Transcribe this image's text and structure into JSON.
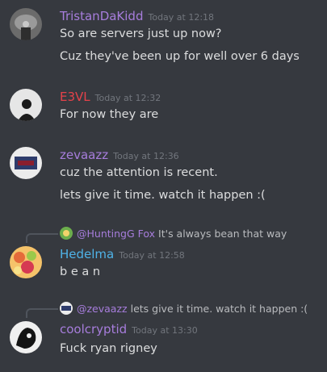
{
  "messages": [
    {
      "username": "TristanDaKidd",
      "name_color": "#a77ddc",
      "timestamp": "Today at 12:18",
      "lines": [
        "So are servers just up now?",
        "Cuz they've been up for well over 6 days"
      ]
    },
    {
      "username": "E3VL",
      "name_color": "#e5424a",
      "timestamp": "Today at 12:32",
      "lines": [
        "For now they are"
      ]
    },
    {
      "username": "zevaazz",
      "name_color": "#a77ddc",
      "timestamp": "Today at 12:36",
      "lines": [
        "cuz the attention is recent.",
        "lets give it time. watch it happen :("
      ]
    },
    {
      "reply": {
        "user": "@HuntingG Fox",
        "user_color": "#a77ddc",
        "text": "It's always bean that way"
      },
      "username": "Hedelma",
      "name_color": "#4fb3e8",
      "timestamp": "Today at 12:58",
      "lines": [
        "b e a n"
      ]
    },
    {
      "reply": {
        "user": "@zevaazz",
        "user_color": "#a77ddc",
        "text": "lets give it time. watch it happen :("
      },
      "username": "coolcryptid",
      "name_color": "#a77ddc",
      "timestamp": "Today at 13:30",
      "lines": [
        "Fuck ryan rigney"
      ]
    }
  ]
}
